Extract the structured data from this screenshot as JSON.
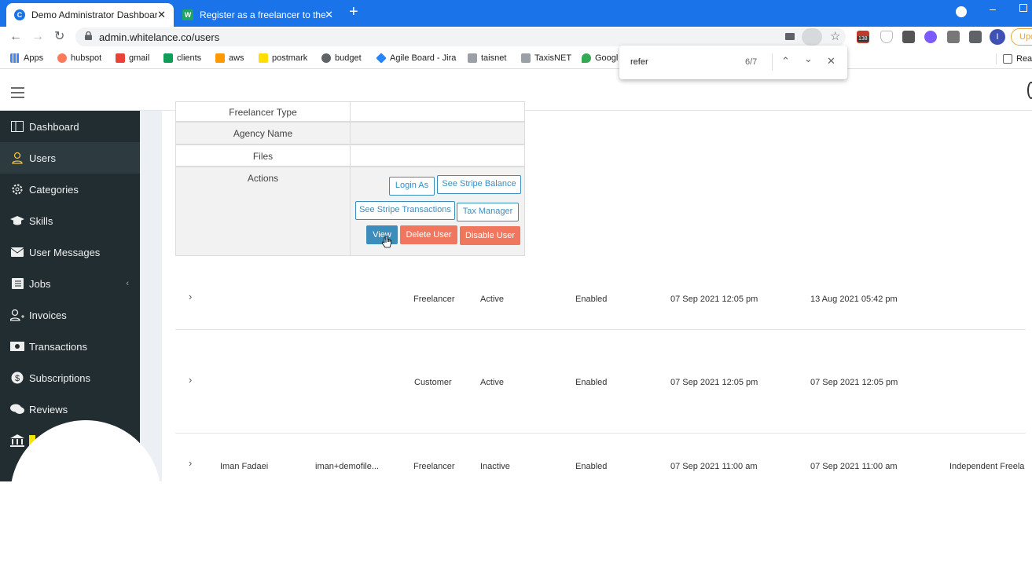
{
  "browser": {
    "tabs": [
      {
        "title": "Demo Administrator Dashboard",
        "active": true
      },
      {
        "title": "Register as a freelancer to the W",
        "active": false
      }
    ],
    "url": "admin.whitelance.co/users",
    "update_label": "Upd",
    "profile_initial": "I",
    "calendar_badge": "138",
    "bookmarks": [
      "Apps",
      "hubspot",
      "gmail",
      "clients",
      "aws",
      "postmark",
      "budget",
      "Agile Board - Jira",
      "taisnet",
      "TaxisNET",
      "Googl"
    ],
    "reading_list": "Rea",
    "find": {
      "query": "refer",
      "count": "6/7"
    }
  },
  "sidebar": {
    "items": [
      {
        "label": "Dashboard",
        "icon": "dashboard-icon"
      },
      {
        "label": "Users",
        "icon": "user-icon"
      },
      {
        "label": "Categories",
        "icon": "gear-icon"
      },
      {
        "label": "Skills",
        "icon": "graduation-cap-icon"
      },
      {
        "label": "User Messages",
        "icon": "envelope-icon"
      },
      {
        "label": "Jobs",
        "icon": "list-icon"
      },
      {
        "label": "Invoices",
        "icon": "user-plus-icon"
      },
      {
        "label": "Transactions",
        "icon": "money-icon"
      },
      {
        "label": "Subscriptions",
        "icon": "dollar-icon"
      },
      {
        "label": "Reviews",
        "icon": "comments-icon"
      }
    ],
    "active": "Users"
  },
  "detail": {
    "rows": [
      {
        "label": "Freelancer Type",
        "value": ""
      },
      {
        "label": "Agency Name",
        "value": ""
      },
      {
        "label": "Files",
        "value": ""
      },
      {
        "label": "Actions",
        "value": ""
      }
    ],
    "actions": {
      "login_as": "Login As",
      "stripe_balance": "See Stripe Balance",
      "stripe_transactions": "See Stripe Transactions",
      "tax_manager": "Tax Manager",
      "view": "View",
      "delete_user": "Delete User",
      "disable_user": "Disable User"
    }
  },
  "users": [
    {
      "name": "",
      "email": "",
      "type": "Freelancer",
      "status": "Active",
      "enabled": "Enabled",
      "created": "07 Sep 2021 12:05 pm",
      "updated": "13 Aug 2021 05:42 pm",
      "extra": ""
    },
    {
      "name": "",
      "email": "",
      "type": "Customer",
      "status": "Active",
      "enabled": "Enabled",
      "created": "07 Sep 2021 12:05 pm",
      "updated": "07 Sep 2021 12:05 pm",
      "extra": ""
    },
    {
      "name": "Iman Fadaei",
      "email": "iman+demofile...",
      "type": "Freelancer",
      "status": "Inactive",
      "enabled": "Enabled",
      "created": "07 Sep 2021 11:00 am",
      "updated": "07 Sep 2021 11:00 am",
      "extra": "Independent Freela"
    }
  ],
  "colors": {
    "tabstrip": "#1a73e8",
    "sidebar": "#222d32",
    "primary": "#3c8dbc",
    "danger": "#f1765e"
  }
}
